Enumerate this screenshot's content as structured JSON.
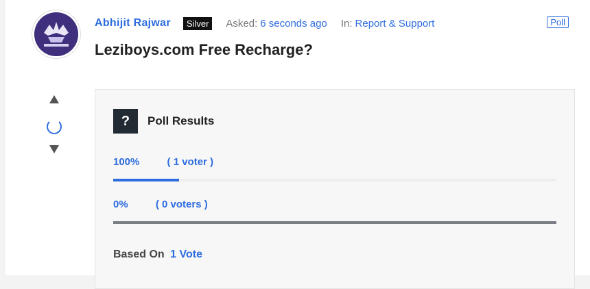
{
  "post": {
    "author": "Abhijit Rajwar",
    "badge": "Silver",
    "asked_label": "Asked:",
    "asked_time": "6 seconds ago",
    "in_label": "In:",
    "category": "Report & Support",
    "tag": "Poll",
    "title": "Leziboys.com Free Recharge?"
  },
  "poll": {
    "icon": "question-icon",
    "icon_glyph": "?",
    "heading": "Poll Results",
    "options": [
      {
        "percent": "100%",
        "votes": "( 1 voter )",
        "fill": 0.149
      },
      {
        "percent": "0%",
        "votes": "( 0 voters )",
        "fill": 0
      }
    ],
    "based_on_label": "Based On",
    "based_on_value": "1 Vote"
  },
  "colors": {
    "accent": "#2d6cdf",
    "badge_bg": "#111111",
    "icon_bg": "#222b33"
  }
}
